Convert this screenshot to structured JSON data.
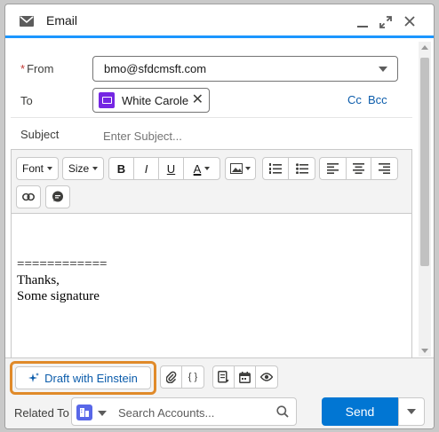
{
  "header": {
    "title": "Email",
    "icons": [
      "email-icon",
      "minimize-icon",
      "expand-icon",
      "close-icon"
    ]
  },
  "from": {
    "required_mark": "*",
    "label": "From",
    "value": "bmo@sfdcmsft.com"
  },
  "to": {
    "label": "To",
    "recipient": "White Carole",
    "cc_label": "Cc",
    "bcc_label": "Bcc"
  },
  "subject": {
    "label": "Subject",
    "placeholder": "Enter Subject..."
  },
  "toolbar": {
    "font_label": "Font",
    "size_label": "Size",
    "bold": "B",
    "italic": "I",
    "underline": "U",
    "text_color": "A"
  },
  "body": {
    "line1": "============",
    "line2": "Thanks,",
    "line3": "Some signature"
  },
  "footer": {
    "einstein_label": "Draft with Einstein",
    "merge_field_label": "{ }",
    "related_label": "Related To",
    "search_placeholder": "Search Accounts...",
    "send_label": "Send"
  },
  "colors": {
    "accent": "#1b96ff",
    "brand_button": "#0176d3",
    "highlight_outline": "#e08a2a",
    "avatar_purple": "#7526e3",
    "object_icon": "#5867e8"
  }
}
